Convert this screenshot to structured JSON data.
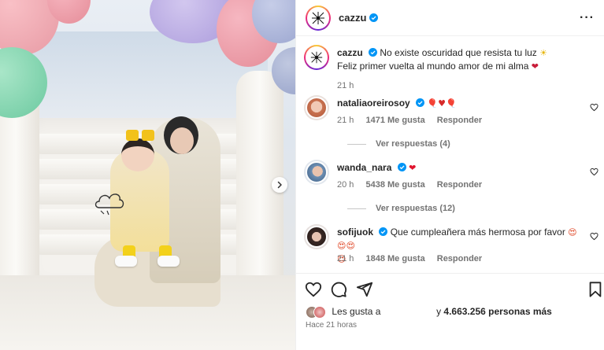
{
  "post": {
    "username": "cazzu",
    "more_icon": "more-options-icon",
    "caption_line1": "No existe oscuridad que resista tu luz",
    "caption_emoji1": "☀",
    "caption_line2": "Feliz primer vuelta al mundo amor de mi alma",
    "caption_emoji2": "❤",
    "caption_time": "21 h"
  },
  "comments": [
    {
      "username": "nataliaoreirosoy",
      "text": "",
      "emoji": "🎈♥🎈",
      "time": "21 h",
      "likes": "1471 Me gusta",
      "reply_label": "Responder",
      "view_replies": "Ver respuestas (4)"
    },
    {
      "username": "wanda_nara",
      "text": "",
      "emoji": "❤",
      "time": "20 h",
      "likes": "5438 Me gusta",
      "reply_label": "Responder",
      "view_replies": "Ver respuestas (12)"
    },
    {
      "username": "sofijuok",
      "text": "Que cumpleañera más hermosa por favor",
      "emoji": "😍😍😍",
      "emoji_line2": "😍",
      "time": "21 h",
      "likes": "1848 Me gusta",
      "reply_label": "Responder"
    }
  ],
  "likes_bar": {
    "prefix": "Les gusta a",
    "suffix_and": "y",
    "count": "4.663.256 personas más",
    "time_ago": "Hace 21 horas"
  },
  "colors": {
    "accent_blue": "#0095f6",
    "heart_red": "#ed4956",
    "meta_gray": "#737373",
    "text": "#262626"
  }
}
